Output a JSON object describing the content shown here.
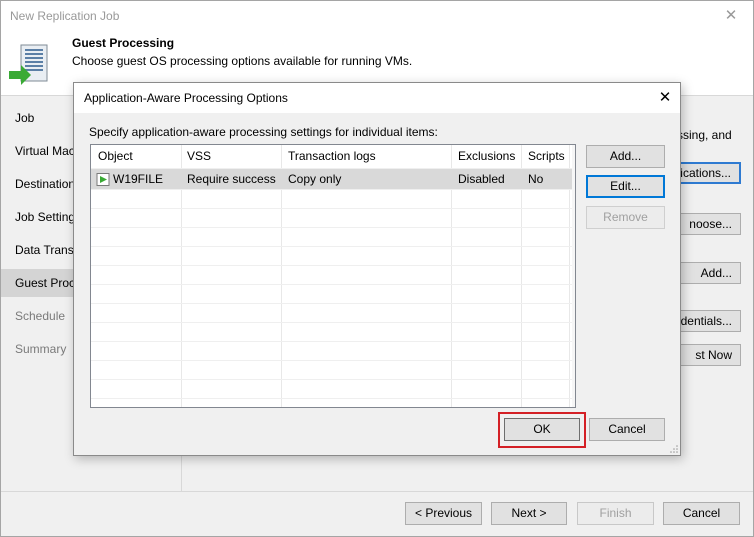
{
  "window": {
    "title": "New Replication Job",
    "close_glyph": "✕"
  },
  "header": {
    "title": "Guest Processing",
    "subtitle": "Choose guest OS processing options available for running VMs.",
    "icon": "server-arrow-icon"
  },
  "nav": {
    "items": [
      {
        "label": "Job",
        "state": "normal"
      },
      {
        "label": "Virtual Mac",
        "state": "normal"
      },
      {
        "label": "Destination",
        "state": "normal"
      },
      {
        "label": "Job Settings",
        "state": "normal"
      },
      {
        "label": "Data Transf",
        "state": "normal"
      },
      {
        "label": "Guest Proce",
        "state": "active"
      },
      {
        "label": "Schedule",
        "state": "disabled"
      },
      {
        "label": "Summary",
        "state": "disabled"
      }
    ]
  },
  "background": {
    "text": "ssing, and",
    "applications_btn": "lications...",
    "choose_btn": "noose...",
    "add_btn": "Add...",
    "credentials_btn": "dentials...",
    "test_btn": "st Now"
  },
  "footer": {
    "previous": "< Previous",
    "next": "Next >",
    "finish": "Finish",
    "cancel": "Cancel"
  },
  "dialog": {
    "title": "Application-Aware Processing Options",
    "close_glyph": "✕",
    "instruction": "Specify application-aware processing settings for individual items:",
    "columns": [
      "Object",
      "VSS",
      "Transaction logs",
      "Exclusions",
      "Scripts"
    ],
    "rows": [
      {
        "object": "W19FILE",
        "vss": "Require success",
        "logs": "Copy only",
        "exclusions": "Disabled",
        "scripts": "No",
        "selected": true
      }
    ],
    "buttons": {
      "add": "Add...",
      "edit": "Edit...",
      "remove": "Remove",
      "ok": "OK",
      "cancel": "Cancel"
    }
  },
  "colors": {
    "focus_blue": "#0078d7",
    "highlight_red": "#d42026",
    "vm_icon_green": "#3aaa35"
  }
}
